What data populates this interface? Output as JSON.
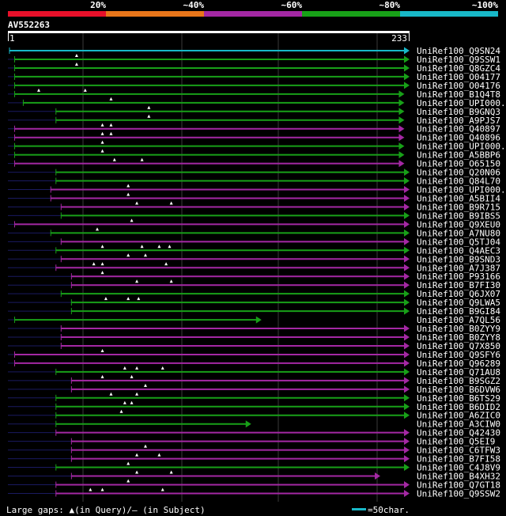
{
  "chart_data": {
    "type": "alignment_overview",
    "query_id": "AV552263",
    "query_length": 233,
    "ruler": {
      "start": "1",
      "end": "233"
    },
    "identity_scale": {
      "labels": [
        "20%",
        "~40%",
        "~60%",
        "~80%",
        "~100%"
      ],
      "colors": [
        "#e8102a",
        "#e8761a",
        "#a428a4",
        "#18a018",
        "#18b8c8"
      ]
    },
    "rows": [
      {
        "label": "UniRef100_Q9SN24",
        "start": 1,
        "end": 233,
        "color": "cyan",
        "tri": []
      },
      {
        "label": "UniRef100_Q9SSW1",
        "start": 4,
        "end": 233,
        "color": "green",
        "tri": [
          40
        ]
      },
      {
        "label": "UniRef100_Q8GZC4",
        "start": 4,
        "end": 233,
        "color": "green",
        "tri": [
          40
        ]
      },
      {
        "label": "UniRef100_O04177",
        "start": 4,
        "end": 233,
        "color": "green",
        "tri": []
      },
      {
        "label": "UniRef100_O04176",
        "start": 4,
        "end": 233,
        "color": "green",
        "tri": []
      },
      {
        "label": "UniRef100_B1Q4T8",
        "start": 4,
        "end": 230,
        "color": "green",
        "tri": [
          18,
          45
        ]
      },
      {
        "label": "UniRef100_UPI000...",
        "start": 9,
        "end": 230,
        "color": "green",
        "tri": [
          60
        ]
      },
      {
        "label": "UniRef100_B9GNQ3",
        "start": 28,
        "end": 230,
        "color": "green",
        "tri": [
          82
        ]
      },
      {
        "label": "UniRef100_A9PJS7",
        "start": 28,
        "end": 230,
        "color": "green",
        "tri": [
          82
        ]
      },
      {
        "label": "UniRef100_Q40897",
        "start": 4,
        "end": 230,
        "color": "purple",
        "tri": [
          55,
          60
        ]
      },
      {
        "label": "UniRef100_Q40896",
        "start": 4,
        "end": 230,
        "color": "purple",
        "tri": [
          55,
          60
        ]
      },
      {
        "label": "UniRef100_UPI000...",
        "start": 4,
        "end": 230,
        "color": "green",
        "tri": [
          55
        ]
      },
      {
        "label": "UniRef100_A5BBP6",
        "start": 4,
        "end": 230,
        "color": "green",
        "tri": [
          55
        ]
      },
      {
        "label": "UniRef100_O65150",
        "start": 4,
        "end": 230,
        "color": "purple",
        "tri": [
          62,
          78
        ]
      },
      {
        "label": "UniRef100_Q20N06",
        "start": 28,
        "end": 233,
        "color": "green",
        "tri": []
      },
      {
        "label": "UniRef100_Q84L70",
        "start": 28,
        "end": 233,
        "color": "green",
        "tri": []
      },
      {
        "label": "UniRef100_UPI000...",
        "start": 25,
        "end": 233,
        "color": "purple",
        "tri": [
          70
        ]
      },
      {
        "label": "UniRef100_A5BII4",
        "start": 25,
        "end": 233,
        "color": "purple",
        "tri": [
          70
        ]
      },
      {
        "label": "UniRef100_B9R715",
        "start": 31,
        "end": 233,
        "color": "purple",
        "tri": [
          75,
          95
        ]
      },
      {
        "label": "UniRef100_B9IBS5",
        "start": 31,
        "end": 233,
        "color": "green",
        "tri": []
      },
      {
        "label": "UniRef100_Q9XEU0",
        "start": 4,
        "end": 233,
        "color": "purple",
        "tri": [
          72
        ]
      },
      {
        "label": "UniRef100_A7NU80",
        "start": 25,
        "end": 233,
        "color": "green",
        "tri": [
          52
        ]
      },
      {
        "label": "UniRef100_Q5TJ04",
        "start": 31,
        "end": 233,
        "color": "purple",
        "tri": []
      },
      {
        "label": "UniRef100_Q4AEC3",
        "start": 28,
        "end": 233,
        "color": "green",
        "tri": [
          55,
          78,
          88,
          94
        ]
      },
      {
        "label": "UniRef100_B9SND3",
        "start": 31,
        "end": 233,
        "color": "purple",
        "tri": [
          70,
          80
        ]
      },
      {
        "label": "UniRef100_A7J387",
        "start": 28,
        "end": 233,
        "color": "purple",
        "tri": [
          50,
          55,
          92
        ]
      },
      {
        "label": "UniRef100_P93166",
        "start": 37,
        "end": 233,
        "color": "purple",
        "tri": [
          55
        ]
      },
      {
        "label": "UniRef100_B7FI30",
        "start": 37,
        "end": 233,
        "color": "purple",
        "tri": [
          75,
          95
        ]
      },
      {
        "label": "UniRef100_Q6JX07",
        "start": 31,
        "end": 233,
        "color": "green",
        "tri": []
      },
      {
        "label": "UniRef100_Q9LWA5",
        "start": 37,
        "end": 233,
        "color": "green",
        "tri": [
          57,
          70,
          76
        ]
      },
      {
        "label": "UniRef100_B9GI84",
        "start": 37,
        "end": 233,
        "color": "green",
        "tri": []
      },
      {
        "label": "UniRef100_A7QL56",
        "start": 4,
        "end": 147,
        "color": "green",
        "tri": []
      },
      {
        "label": "UniRef100_B0ZYY9",
        "start": 31,
        "end": 233,
        "color": "purple",
        "tri": []
      },
      {
        "label": "UniRef100_B0ZYY8",
        "start": 31,
        "end": 233,
        "color": "purple",
        "tri": []
      },
      {
        "label": "UniRef100_Q7X850",
        "start": 31,
        "end": 233,
        "color": "purple",
        "tri": []
      },
      {
        "label": "UniRef100_Q9SFY6",
        "start": 4,
        "end": 233,
        "color": "purple",
        "tri": [
          55
        ]
      },
      {
        "label": "UniRef100_Q96289",
        "start": 4,
        "end": 233,
        "color": "purple",
        "tri": []
      },
      {
        "label": "UniRef100_Q71AU8",
        "start": 28,
        "end": 233,
        "color": "green",
        "tri": [
          68,
          75,
          90
        ]
      },
      {
        "label": "UniRef100_B9SGZ2",
        "start": 37,
        "end": 233,
        "color": "purple",
        "tri": [
          55,
          72
        ]
      },
      {
        "label": "UniRef100_B6DVW6",
        "start": 37,
        "end": 233,
        "color": "purple",
        "tri": [
          80
        ]
      },
      {
        "label": "UniRef100_B6TS29",
        "start": 28,
        "end": 233,
        "color": "green",
        "tri": [
          60,
          75
        ]
      },
      {
        "label": "UniRef100_B6DID2",
        "start": 28,
        "end": 233,
        "color": "green",
        "tri": [
          68,
          72
        ]
      },
      {
        "label": "UniRef100_A6ZIC0",
        "start": 28,
        "end": 233,
        "color": "green",
        "tri": [
          66
        ]
      },
      {
        "label": "UniRef100_A3CIW0",
        "start": 28,
        "end": 141,
        "color": "green",
        "tri": []
      },
      {
        "label": "UniRef100_Q42430",
        "start": 28,
        "end": 233,
        "color": "purple",
        "tri": []
      },
      {
        "label": "UniRef100_Q5EI9",
        "start": 37,
        "end": 233,
        "color": "purple",
        "tri": []
      },
      {
        "label": "UniRef100_C6TFW3",
        "start": 37,
        "end": 233,
        "color": "purple",
        "tri": [
          80
        ]
      },
      {
        "label": "UniRef100_B7FI58",
        "start": 37,
        "end": 233,
        "color": "purple",
        "tri": [
          75,
          88
        ]
      },
      {
        "label": "UniRef100_C4J8V9",
        "start": 28,
        "end": 233,
        "color": "green",
        "tri": [
          70
        ]
      },
      {
        "label": "UniRef100_B4XH32",
        "start": 37,
        "end": 216,
        "color": "purple",
        "tri": [
          75,
          95
        ]
      },
      {
        "label": "UniRef100_Q7GT18",
        "start": 28,
        "end": 233,
        "color": "purple",
        "tri": [
          70
        ]
      },
      {
        "label": "UniRef100_Q9SSW2",
        "start": 28,
        "end": 233,
        "color": "purple",
        "tri": [
          48,
          55,
          90
        ]
      }
    ],
    "legend": {
      "gaps_text": "Large gaps: ▲(in Query)/— (in Subject)",
      "scale_text": "=50char."
    }
  }
}
